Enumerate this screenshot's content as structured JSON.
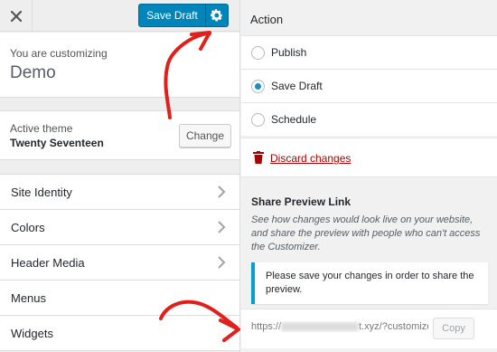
{
  "topbar": {
    "close_icon": "close-icon",
    "save_draft_label": "Save Draft",
    "settings_icon": "gear-icon",
    "accent": "#0085ba"
  },
  "customizing": {
    "label": "You are customizing",
    "title": "Demo"
  },
  "theme": {
    "label": "Active theme",
    "name": "Twenty Seventeen",
    "change_label": "Change"
  },
  "nav": {
    "items": [
      {
        "label": "Site Identity",
        "has_chevron": true
      },
      {
        "label": "Colors",
        "has_chevron": true
      },
      {
        "label": "Header Media",
        "has_chevron": true
      },
      {
        "label": "Menus",
        "has_chevron": false
      },
      {
        "label": "Widgets",
        "has_chevron": false
      }
    ]
  },
  "action": {
    "heading": "Action",
    "options": [
      {
        "label": "Publish",
        "checked": false
      },
      {
        "label": "Save Draft",
        "checked": true
      },
      {
        "label": "Schedule",
        "checked": false
      }
    ],
    "discard_label": "Discard changes",
    "discard_color": "#aa0000"
  },
  "share": {
    "heading": "Share Preview Link",
    "description": "See how changes would look live on your website, and share the preview with people who can't access the Customizer.",
    "notice": "Please save your changes in order to share the preview.",
    "notice_color": "#00a0d2",
    "url_prefix": "https://",
    "url_suffix": "t.xyz/?customize",
    "copy_label": "Copy"
  },
  "annotations": {
    "arrow_color": "#e0201b"
  }
}
